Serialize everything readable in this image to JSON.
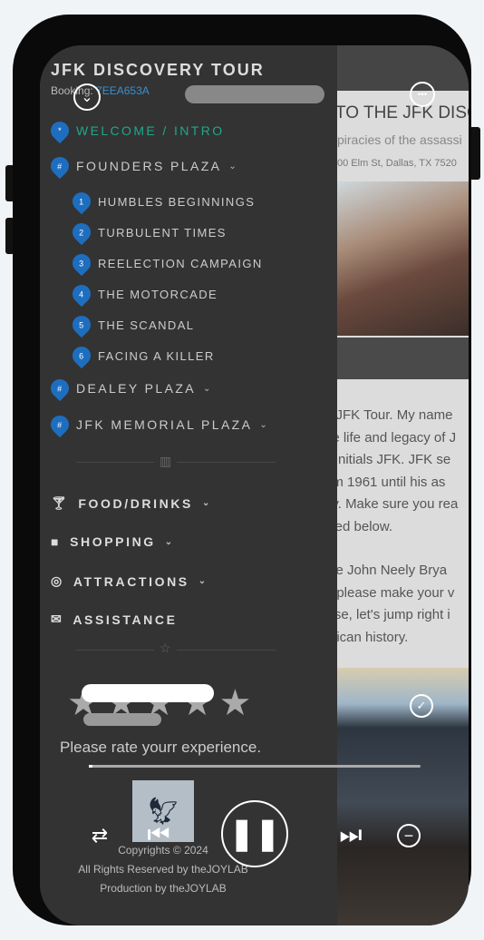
{
  "header": {
    "title": "JFK DISCOVERY TOUR",
    "booking_label": "Booking:",
    "booking_code": "7EEA653A"
  },
  "nav": {
    "items": [
      {
        "label": "WELCOME / INTRO",
        "badge": "*",
        "active": true
      },
      {
        "label": "FOUNDERS PLAZA",
        "badge": "#",
        "expanded": true,
        "children": [
          {
            "n": "1",
            "label": "HUMBLES BEGINNINGS"
          },
          {
            "n": "2",
            "label": "TURBULENT TIMES"
          },
          {
            "n": "3",
            "label": "REELECTION CAMPAIGN"
          },
          {
            "n": "4",
            "label": "THE MOTORCADE"
          },
          {
            "n": "5",
            "label": "THE SCANDAL"
          },
          {
            "n": "6",
            "label": "FACING A KILLER"
          }
        ]
      },
      {
        "label": "DEALEY PLAZA",
        "badge": "#"
      },
      {
        "label": "JFK MEMORIAL PLAZA",
        "badge": "#"
      }
    ],
    "categories": [
      {
        "label": "FOOD/DRINKS",
        "icon": "cocktail-icon"
      },
      {
        "label": "SHOPPING",
        "icon": "bag-icon"
      },
      {
        "label": "ATTRACTIONS",
        "icon": "camera-icon"
      },
      {
        "label": "ASSISTANCE",
        "icon": "mail-icon"
      }
    ]
  },
  "rating": {
    "prompt": "Please rate yourr experience.",
    "stars": 5
  },
  "footer": {
    "line1": "Copyrights © 2024",
    "line2": "All Rights Reserved by theJOYLAB",
    "line3": "Production by theJOYLAB"
  },
  "content": {
    "heading": "TO THE JFK DISC",
    "subtitle": "piracies of the assassi",
    "address": "00 Elm St, Dallas, TX 7520",
    "paragraph1": [
      "e JFK Tour. My name",
      "he life and legacy of J",
      "s initials JFK. JFK se",
      "om 1961 until his as",
      "ay. Make sure you rea",
      "sted below."
    ],
    "paragraph2": [
      "the John Neely Brya",
      "), please make your v",
      "vise, let's jump right i",
      "erican history."
    ]
  },
  "player": {
    "progress": 0.01
  },
  "colors": {
    "accent": "#1fa88a",
    "pin": "#1e6ec0",
    "drawer": "#333333"
  }
}
